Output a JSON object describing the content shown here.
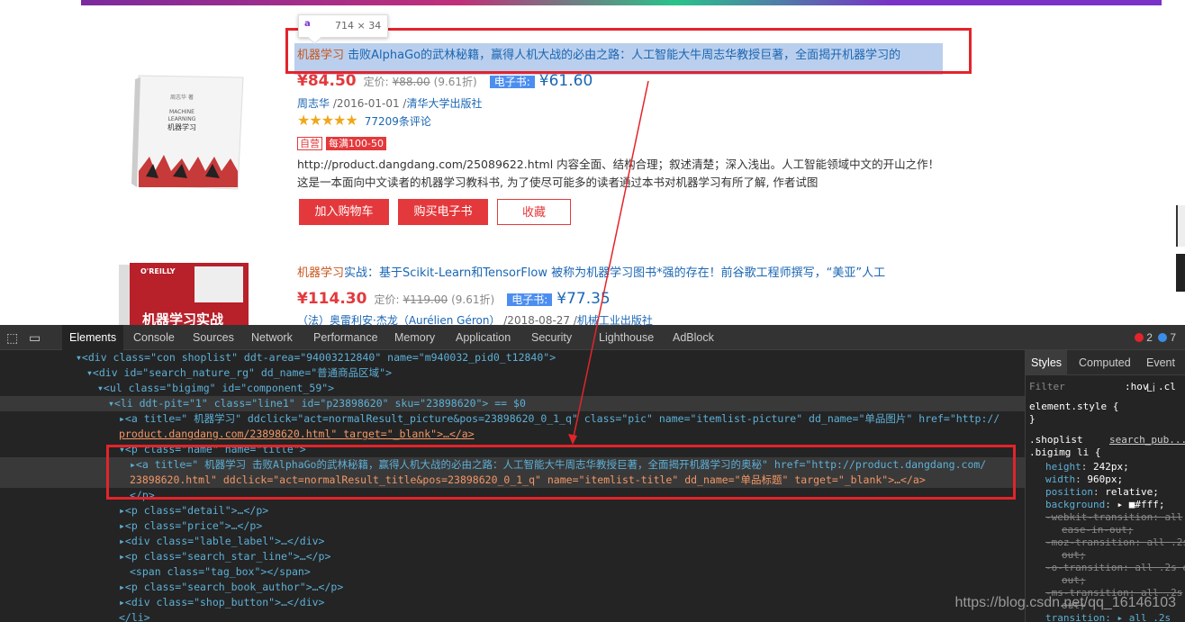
{
  "tooltip": {
    "size": "714 × 34"
  },
  "products": [
    {
      "title_kw": "机器学习",
      "title_rest": " 击败AlphaGo的武林秘籍，赢得人机大战的必由之路：人工智能大牛周志华教授巨著，全面揭开机器学习的",
      "price_now": "¥84.50",
      "price_label": "定价:",
      "price_old": "¥88.00",
      "discount": "(9.61折)",
      "ebook_label": "电子书:",
      "ebook_price": "¥61.60",
      "author": "周志华",
      "date": " /2016-01-01 /",
      "publisher": "清华大学出版社",
      "stars": "★★★★★",
      "reviews": "77209条评论",
      "tag_self": "自营",
      "tag_promo": "每满100-50",
      "detail": "http://product.dangdang.com/25089622.html 内容全面、结构合理；叙述清楚；深入浅出。人工智能领域中文的开山之作！ 这是一本面向中文读者的机器学习教科书, 为了使尽可能多的读者通过本书对机器学习有所了解, 作者试图",
      "btn_cart": "加入购物车",
      "btn_ebook": "购买电子书",
      "btn_fav": "收藏",
      "cover_lines": [
        "机器学习",
        "MACHINE",
        "LEARNING",
        "机器学习"
      ]
    },
    {
      "title_kw": "机器学习",
      "title_rest": "实战：基于Scikit-Learn和TensorFlow 被称为机器学习图书*强的存在！前谷歌工程师撰写，“美亚”人工",
      "price_now": "¥114.30",
      "price_label": "定价:",
      "price_old": "¥119.00",
      "discount": "(9.61折)",
      "ebook_label": "电子书:",
      "ebook_price": "¥77.35",
      "author": "（法）奥雷利安·杰龙（Aurélien Géron）",
      "date": " /2018-08-27 /",
      "publisher": "机械工业出版社",
      "cover_brand": "O'REILLY",
      "cover_title": "机器学习实战"
    }
  ],
  "devtools": {
    "tabs": [
      "Elements",
      "Console",
      "Sources",
      "Network",
      "Performance",
      "Memory",
      "Application",
      "Security",
      "Lighthouse",
      "AdBlock"
    ],
    "errors": "2",
    "warnings": "7",
    "style_tabs": [
      "Styles",
      "Computed",
      "Event Li"
    ],
    "filter_placeholder": "Filter",
    "hov": ":hov",
    "cls": ".cl"
  },
  "tree": [
    "▾<div class=\"con shoplist\" ddt-area=\"94003212840\" name=\"m940032_pid0_t12840\">",
    "▾<div id=\"search_nature_rg\" dd_name=\"普通商品区域\">",
    "▾<ul class=\"bigimg\" id=\"component_59\">",
    "▾<li ddt-pit=\"1\" class=\"line1\" id=\"p23898620\" sku=\"23898620\"> == $0",
    "▸<a title=\" 机器学习\" ddclick=\"act=normalResult_picture&pos=23898620_0_1_q\" class=\"pic\" name=\"itemlist-picture\" dd_name=\"单品图片\" href=\"http://",
    "product.dangdang.com/23898620.html\" target=\"_blank\">…</a>",
    "▾<p class=\"name\" name=\"title\">",
    "▸<a title=\" 机器学习 击败AlphaGo的武林秘籍，赢得人机大战的必由之路：人工智能大牛周志华教授巨著，全面揭开机器学习的奥秘\" href=\"http://product.dangdang.com/",
    "23898620.html\" ddclick=\"act=normalResult_title&pos=23898620_0_1_q\" name=\"itemlist-title\" dd_name=\"单品标题\" target=\"_blank\">…</a>",
    "</p>",
    "▸<p class=\"detail\">…</p>",
    "▸<p class=\"price\">…</p>",
    "▸<div class=\"lable_label\">…</div>",
    "▸<p class=\"search_star_line\">…</p>",
    "<span class=\"tag_box\"></span>",
    "▸<p class=\"search_book_author\">…</p>",
    "▸<div class=\"shop_button\">…</div>",
    "</li>"
  ],
  "styles": {
    "element_style": "element.style {",
    "close": "}",
    "selector1": ".shoplist",
    "source": "search_pub...",
    "selector2": ".bigimg li {",
    "rules": [
      {
        "p": "height",
        "v": "242px;"
      },
      {
        "p": "width",
        "v": "960px;"
      },
      {
        "p": "position",
        "v": "relative;"
      },
      {
        "p": "background",
        "v": "▸ ■#fff;"
      }
    ],
    "struck": [
      "-webkit-transition: all",
      "ease-in-out;",
      "-moz-transition: all .2s",
      "out;",
      "-o-transition: all .2s e",
      "out;",
      "-ms-transition: all .2s",
      "out;",
      "transition: ▸ all .2s"
    ]
  },
  "watermark": "https://blog.csdn.net/qq_16146103"
}
